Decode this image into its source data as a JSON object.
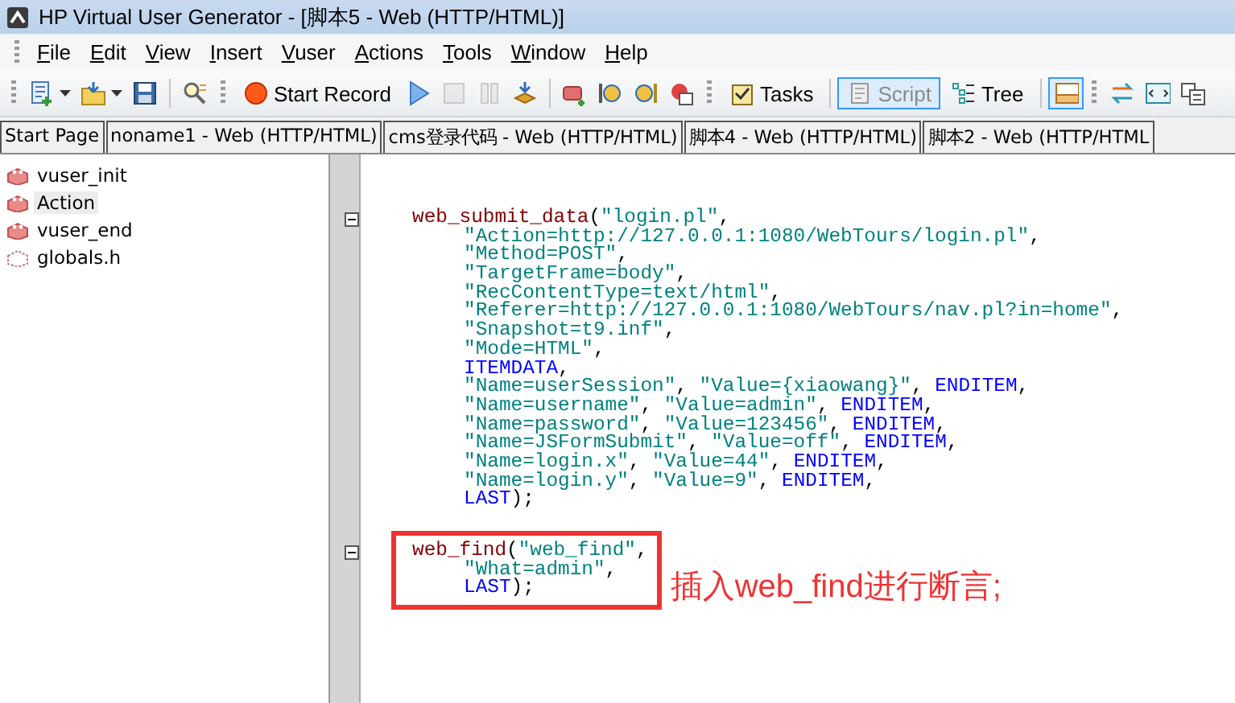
{
  "window": {
    "title": "HP Virtual User Generator - [脚本5 - Web (HTTP/HTML)]"
  },
  "menu": [
    "File",
    "Edit",
    "View",
    "Insert",
    "Vuser",
    "Actions",
    "Tools",
    "Window",
    "Help"
  ],
  "toolbar": [
    {
      "kind": "dropdown",
      "disabled": false
    },
    {
      "kind": "dropdown",
      "disabled": false
    },
    {
      "kind": "icon",
      "disabled": false
    },
    {
      "kind": "separator"
    },
    {
      "kind": "icon",
      "disabled": false
    },
    {
      "kind": "grip"
    },
    {
      "kind": "labeled",
      "label": "Start Record",
      "disabled": false
    },
    {
      "kind": "icon",
      "disabled": false
    },
    {
      "kind": "icon",
      "disabled": true
    },
    {
      "kind": "icon",
      "disabled": true
    },
    {
      "kind": "icon",
      "disabled": false
    },
    {
      "kind": "separator"
    },
    {
      "kind": "icon",
      "disabled": false
    },
    {
      "kind": "icon",
      "disabled": false
    },
    {
      "kind": "icon",
      "disabled": false
    },
    {
      "kind": "icon",
      "disabled": false
    },
    {
      "kind": "grip"
    },
    {
      "kind": "labeled",
      "label": "Tasks",
      "selected": false
    },
    {
      "kind": "separator"
    },
    {
      "kind": "labeled",
      "label": "Script",
      "selected": true
    },
    {
      "kind": "labeled",
      "label": "Tree",
      "selected": false
    },
    {
      "kind": "separator"
    },
    {
      "kind": "icon",
      "selected": true
    },
    {
      "kind": "grip"
    },
    {
      "kind": "icon",
      "disabled": false
    },
    {
      "kind": "icon",
      "disabled": false
    },
    {
      "kind": "icon",
      "disabled": false
    }
  ],
  "tabs": [
    {
      "label": "Start Page",
      "selected": false
    },
    {
      "label": "noname1 - Web (HTTP/HTML)",
      "selected": false
    },
    {
      "label": "cms登录代码 - Web (HTTP/HTML)",
      "selected": false
    },
    {
      "label": "脚本4 - Web (HTTP/HTML)",
      "selected": false
    },
    {
      "label": "脚本2 - Web (HTTP/HTML",
      "selected": false
    }
  ],
  "sidebar": {
    "items": [
      {
        "label": "vuser_init",
        "kind": "action",
        "selected": false
      },
      {
        "label": "Action",
        "kind": "action",
        "selected": true
      },
      {
        "label": "vuser_end",
        "kind": "action",
        "selected": false
      },
      {
        "label": "globals.h",
        "kind": "header",
        "selected": false
      }
    ]
  },
  "editor": {
    "blocks": [
      {
        "highlighted": false,
        "lines": [
          {
            "kind": "head",
            "tokens": [
              {
                "kind": "function",
                "text": "web_submit_data"
              },
              {
                "kind": "punct",
                "text": "("
              },
              {
                "kind": "string",
                "text": "\"login.pl\""
              },
              {
                "kind": "punct",
                "text": ","
              }
            ]
          },
          {
            "kind": "arg",
            "tokens": [
              {
                "kind": "string",
                "text": "\"Action=http://127.0.0.1:1080/WebTours/login.pl\""
              },
              {
                "kind": "punct",
                "text": ","
              }
            ]
          },
          {
            "kind": "arg",
            "tokens": [
              {
                "kind": "string",
                "text": "\"Method=POST\""
              },
              {
                "kind": "punct",
                "text": ","
              }
            ]
          },
          {
            "kind": "arg",
            "tokens": [
              {
                "kind": "string",
                "text": "\"TargetFrame=body\""
              },
              {
                "kind": "punct",
                "text": ","
              }
            ]
          },
          {
            "kind": "arg",
            "tokens": [
              {
                "kind": "string",
                "text": "\"RecContentType=text/html\""
              },
              {
                "kind": "punct",
                "text": ","
              }
            ]
          },
          {
            "kind": "arg",
            "tokens": [
              {
                "kind": "string",
                "text": "\"Referer=http://127.0.0.1:1080/WebTours/nav.pl?in=home\""
              },
              {
                "kind": "punct",
                "text": ","
              }
            ]
          },
          {
            "kind": "arg",
            "tokens": [
              {
                "kind": "string",
                "text": "\"Snapshot=t9.inf\""
              },
              {
                "kind": "punct",
                "text": ","
              }
            ]
          },
          {
            "kind": "arg",
            "tokens": [
              {
                "kind": "string",
                "text": "\"Mode=HTML\""
              },
              {
                "kind": "punct",
                "text": ","
              }
            ]
          },
          {
            "kind": "arg",
            "tokens": [
              {
                "kind": "keyword",
                "text": "ITEMDATA"
              },
              {
                "kind": "punct",
                "text": ","
              }
            ]
          },
          {
            "kind": "arg",
            "tokens": [
              {
                "kind": "string",
                "text": "\"Name=userSession\""
              },
              {
                "kind": "punct",
                "text": ", "
              },
              {
                "kind": "string",
                "text": "\"Value={xiaowang}\""
              },
              {
                "kind": "punct",
                "text": ", "
              },
              {
                "kind": "keyword",
                "text": "ENDITEM"
              },
              {
                "kind": "punct",
                "text": ","
              }
            ]
          },
          {
            "kind": "arg",
            "tokens": [
              {
                "kind": "string",
                "text": "\"Name=username\""
              },
              {
                "kind": "punct",
                "text": ", "
              },
              {
                "kind": "string",
                "text": "\"Value=admin\""
              },
              {
                "kind": "punct",
                "text": ", "
              },
              {
                "kind": "keyword",
                "text": "ENDITEM"
              },
              {
                "kind": "punct",
                "text": ","
              }
            ]
          },
          {
            "kind": "arg",
            "tokens": [
              {
                "kind": "string",
                "text": "\"Name=password\""
              },
              {
                "kind": "punct",
                "text": ", "
              },
              {
                "kind": "string",
                "text": "\"Value=123456\""
              },
              {
                "kind": "punct",
                "text": ", "
              },
              {
                "kind": "keyword",
                "text": "ENDITEM"
              },
              {
                "kind": "punct",
                "text": ","
              }
            ]
          },
          {
            "kind": "arg",
            "tokens": [
              {
                "kind": "string",
                "text": "\"Name=JSFormSubmit\""
              },
              {
                "kind": "punct",
                "text": ", "
              },
              {
                "kind": "string",
                "text": "\"Value=off\""
              },
              {
                "kind": "punct",
                "text": ", "
              },
              {
                "kind": "keyword",
                "text": "ENDITEM"
              },
              {
                "kind": "punct",
                "text": ","
              }
            ]
          },
          {
            "kind": "arg",
            "tokens": [
              {
                "kind": "string",
                "text": "\"Name=login.x\""
              },
              {
                "kind": "punct",
                "text": ", "
              },
              {
                "kind": "string",
                "text": "\"Value=44\""
              },
              {
                "kind": "punct",
                "text": ", "
              },
              {
                "kind": "keyword",
                "text": "ENDITEM"
              },
              {
                "kind": "punct",
                "text": ","
              }
            ]
          },
          {
            "kind": "arg",
            "tokens": [
              {
                "kind": "string",
                "text": "\"Name=login.y\""
              },
              {
                "kind": "punct",
                "text": ", "
              },
              {
                "kind": "string",
                "text": "\"Value=9\""
              },
              {
                "kind": "punct",
                "text": ", "
              },
              {
                "kind": "keyword",
                "text": "ENDITEM"
              },
              {
                "kind": "punct",
                "text": ","
              }
            ]
          },
          {
            "kind": "arg",
            "tokens": [
              {
                "kind": "keyword",
                "text": "LAST"
              },
              {
                "kind": "punct",
                "text": ");"
              }
            ]
          }
        ]
      },
      {
        "highlighted": true,
        "note": "插入web_find进行断言;",
        "lines": [
          {
            "kind": "head",
            "tokens": [
              {
                "kind": "function",
                "text": "web_find"
              },
              {
                "kind": "punct",
                "text": "("
              },
              {
                "kind": "string",
                "text": "\"web_find\""
              },
              {
                "kind": "punct",
                "text": ","
              }
            ]
          },
          {
            "kind": "arg",
            "tokens": [
              {
                "kind": "string",
                "text": "\"What=admin\""
              },
              {
                "kind": "punct",
                "text": ","
              }
            ]
          },
          {
            "kind": "arg",
            "tokens": [
              {
                "kind": "keyword",
                "text": "LAST"
              },
              {
                "kind": "punct",
                "text": ");"
              }
            ]
          }
        ]
      }
    ]
  }
}
